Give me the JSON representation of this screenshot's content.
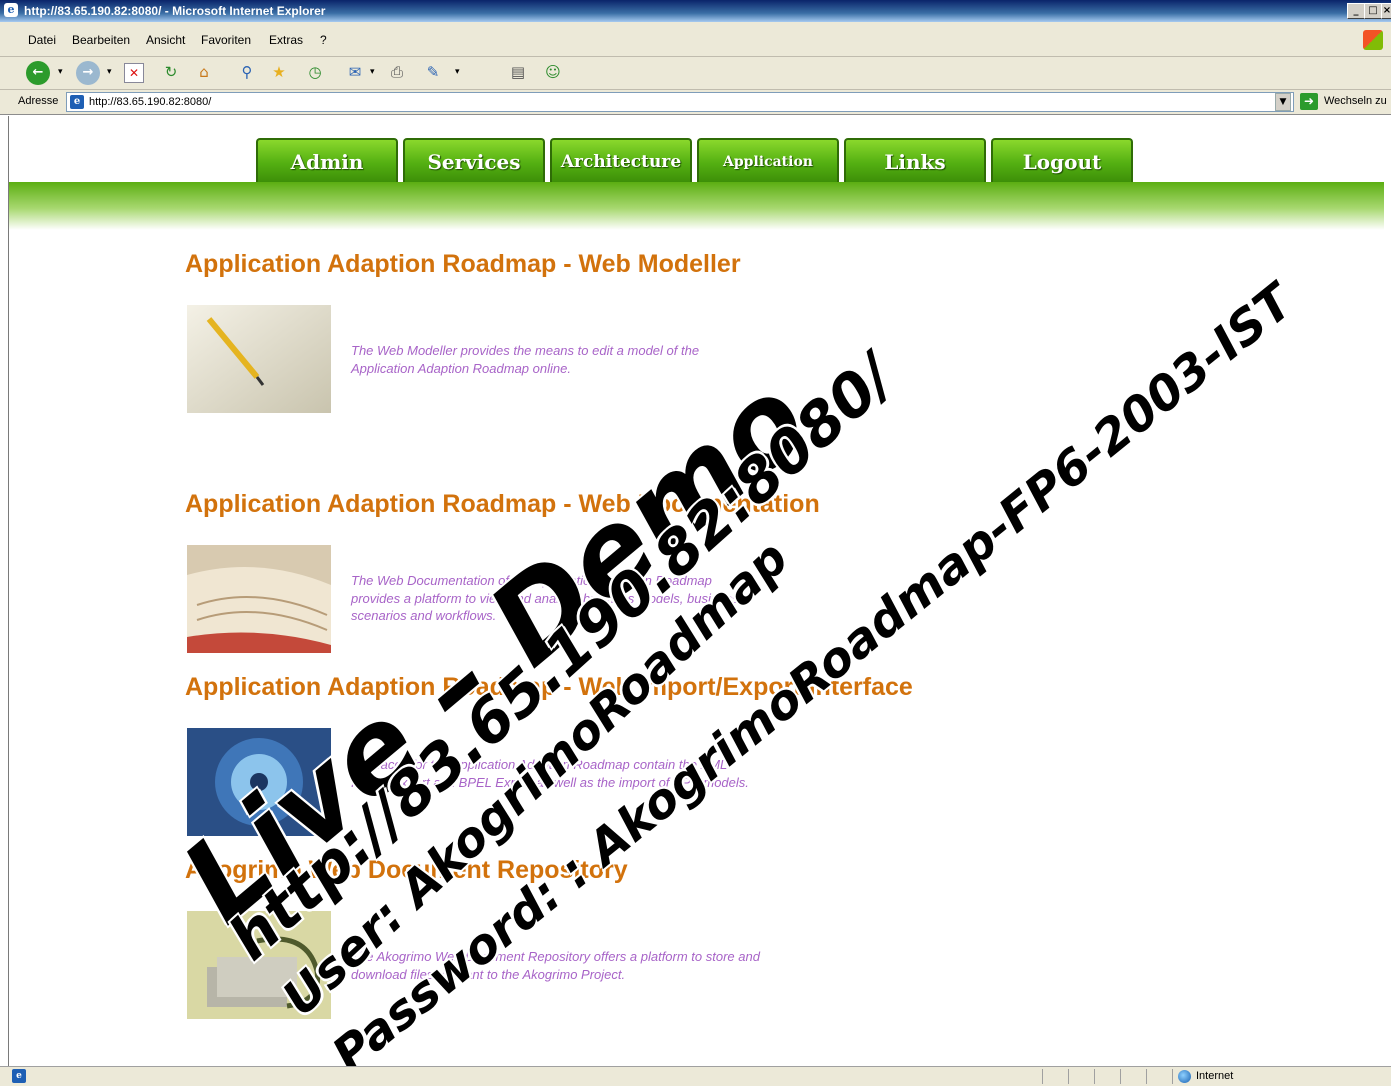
{
  "window": {
    "title": "http://83.65.190.82:8080/ - Microsoft Internet Explorer",
    "controls": [
      "_",
      "□",
      "×"
    ]
  },
  "menu": [
    "Datei",
    "Bearbeiten",
    "Ansicht",
    "Favoriten",
    "Extras",
    "?"
  ],
  "toolbar": {
    "back_icon": "back-arrow-icon",
    "forward_icon": "forward-arrow-icon",
    "buttons": [
      "stop-icon",
      "refresh-icon",
      "home-icon",
      "search-icon",
      "favorites-icon",
      "history-icon",
      "mail-icon",
      "print-icon",
      "edit-icon",
      "discuss-icon",
      "messenger-icon"
    ]
  },
  "address": {
    "label": "Adresse",
    "url": "http://83.65.190.82:8080/",
    "go_label": "Wechseln zu"
  },
  "nav": {
    "tabs": [
      "Admin",
      "Services",
      "Architecture",
      "Application",
      "Links",
      "Logout"
    ],
    "active": "Application",
    "brand_green": "#54b012"
  },
  "sections": [
    {
      "title": "Application Adaption Roadmap - Web Modeller",
      "image": "pencil-paper-image",
      "description": "The Web Modeller provides the means to edit a model of the Application Adaption Roadmap online."
    },
    {
      "title": "Application Adaption Roadmap - Web Documentation",
      "image": "open-book-image",
      "description": "The Web Documentation of the Application Adaption Roadmap provides a platform to view and analyze business models, business scenarios and workflows."
    },
    {
      "title": "Application Adaption Roadmap - Web Import/Export Interface",
      "image": "data-disc-image",
      "description": "Interfaces for the Application Adaption Roadmap contain the XML Import-Export and BPEL Export as well as the import of EPC models."
    },
    {
      "title": "Akogrimo Web Document Repository",
      "image": "paper-clips-image",
      "description": "The Akogrimo Web Document Repository offers a platform to store and download files relevant to the Akogrimo Project."
    }
  ],
  "watermark": {
    "line1": "Live – Demo",
    "line2": "http://83.65.190.82:8080/",
    "line3": "User: AkogrimoRoadmap",
    "line4": "Password: : AkogrimoRoadmap-FP6-2003-IST"
  },
  "status": {
    "zone": "Internet"
  },
  "colors": {
    "title_orange": "#d2720c",
    "desc_purple": "#a864c8"
  }
}
